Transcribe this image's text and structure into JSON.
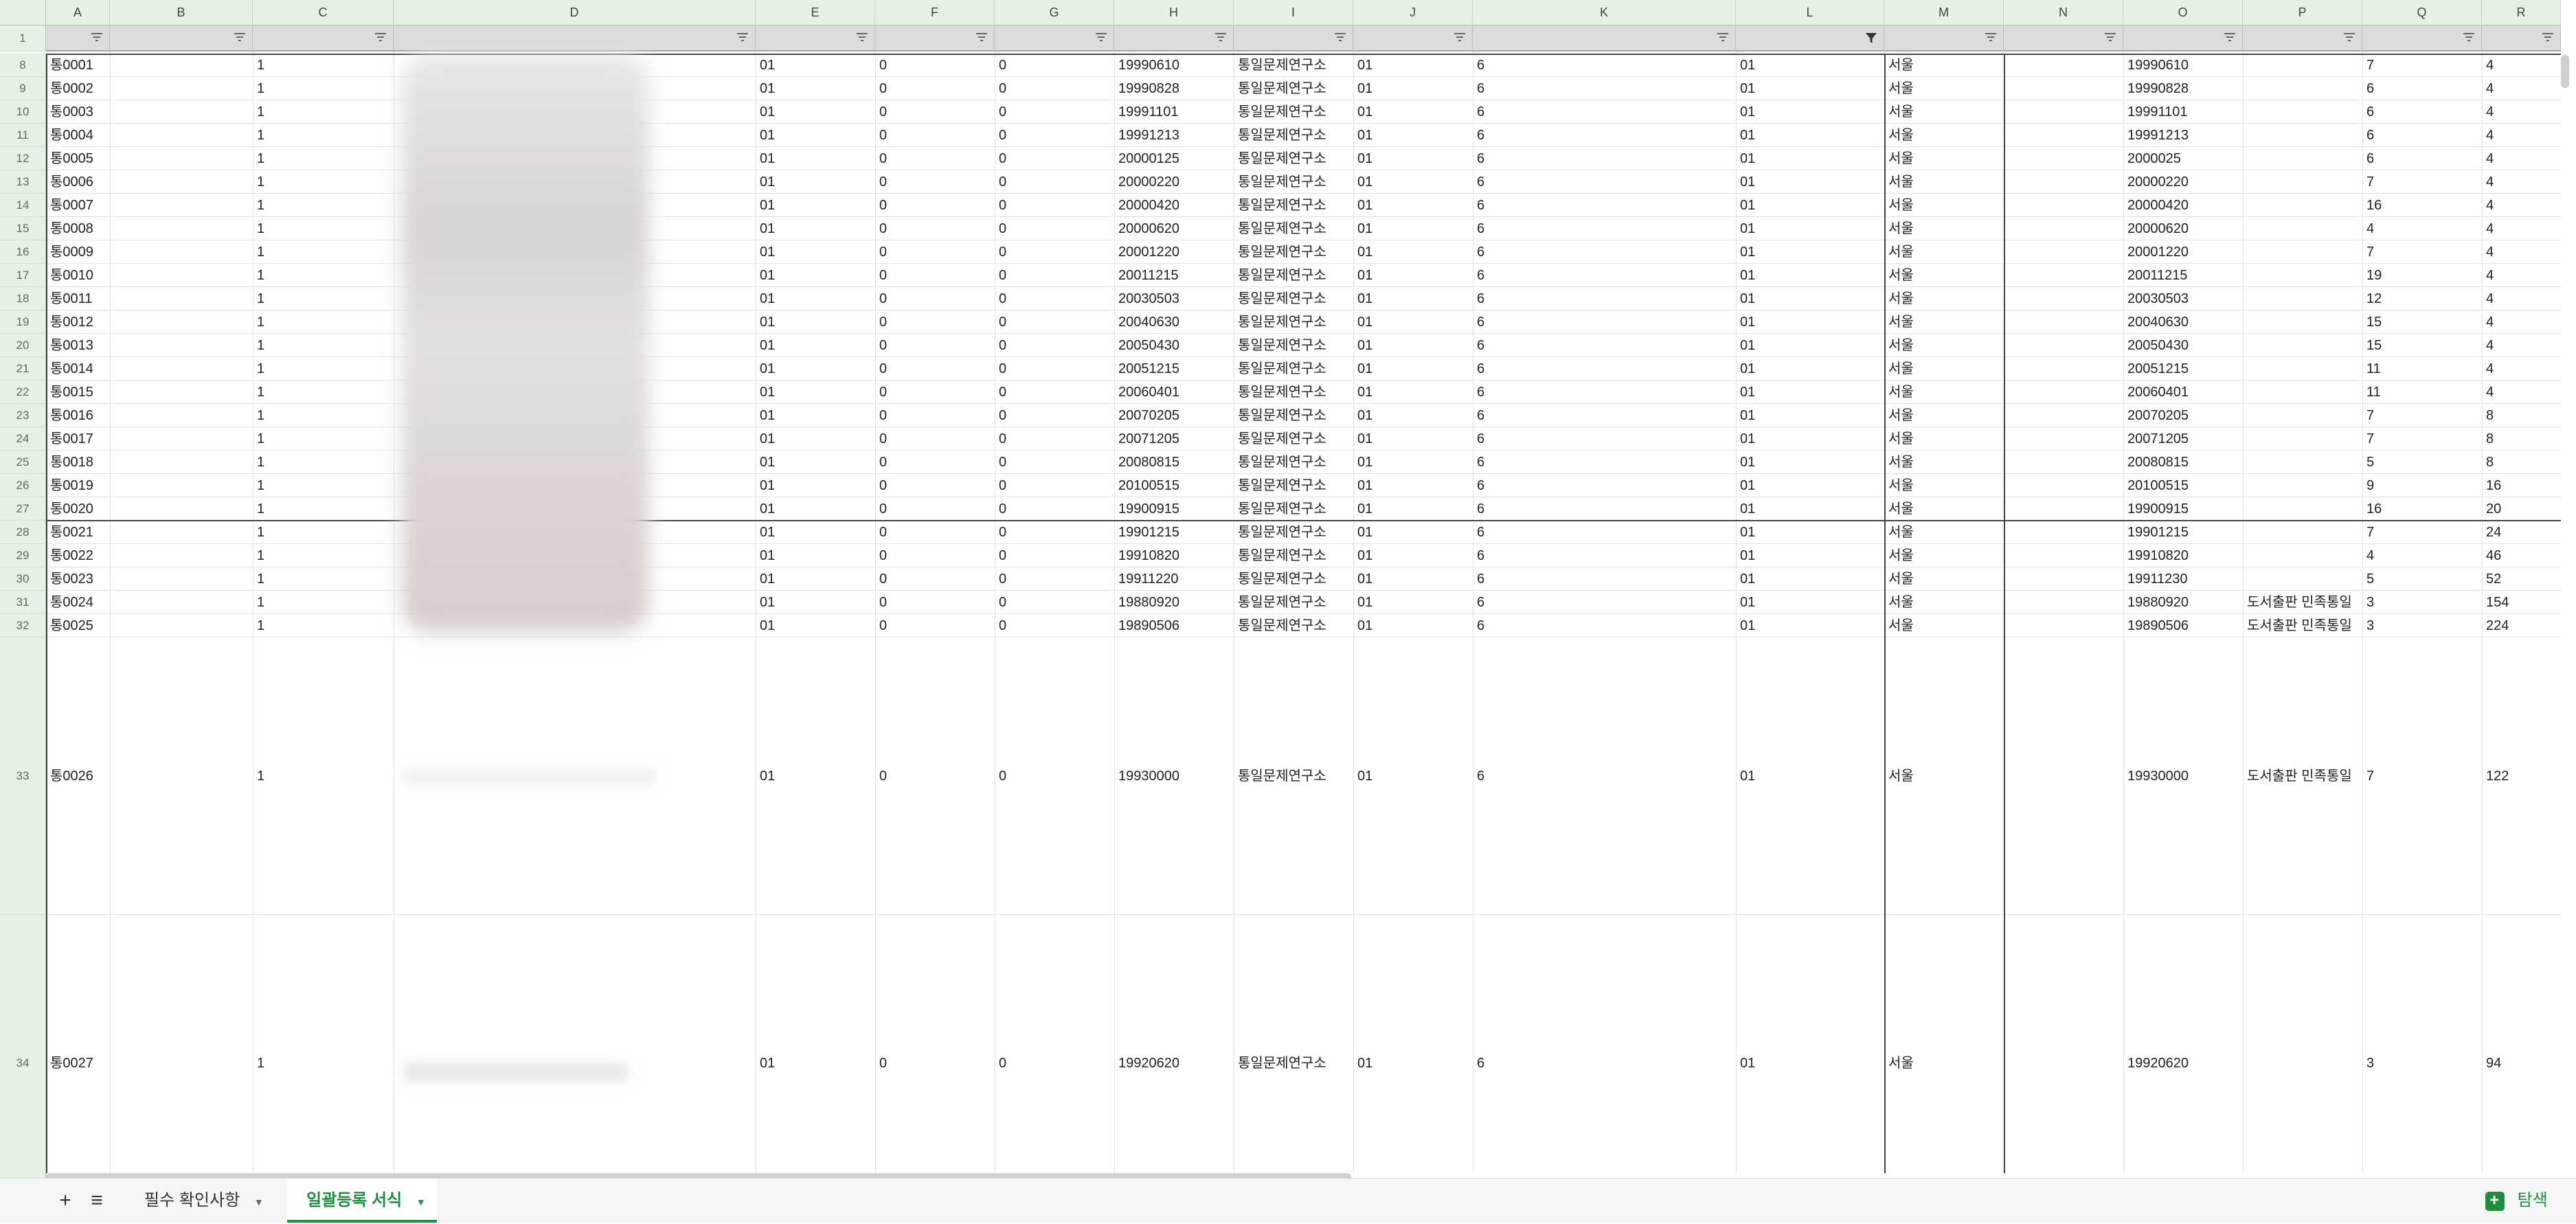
{
  "columns": [
    "A",
    "B",
    "C",
    "D",
    "E",
    "F",
    "G",
    "H",
    "I",
    "J",
    "K",
    "L",
    "M",
    "N",
    "O",
    "P",
    "Q",
    "R"
  ],
  "first_row_number": "1",
  "rows": [
    {
      "num": "8",
      "A": "통0001",
      "C": "1",
      "E": "01",
      "F": "0",
      "G": "0",
      "H": "19990610",
      "I": "통일문제연구소",
      "J": "01",
      "K": "6",
      "L": "01",
      "M": "서울",
      "O": "19990610",
      "P": "",
      "Q": "7",
      "R": "4"
    },
    {
      "num": "9",
      "A": "통0002",
      "C": "1",
      "E": "01",
      "F": "0",
      "G": "0",
      "H": "19990828",
      "I": "통일문제연구소",
      "J": "01",
      "K": "6",
      "L": "01",
      "M": "서울",
      "O": "19990828",
      "P": "",
      "Q": "6",
      "R": "4"
    },
    {
      "num": "10",
      "A": "통0003",
      "C": "1",
      "E": "01",
      "F": "0",
      "G": "0",
      "H": "19991101",
      "I": "통일문제연구소",
      "J": "01",
      "K": "6",
      "L": "01",
      "M": "서울",
      "O": "19991101",
      "P": "",
      "Q": "6",
      "R": "4"
    },
    {
      "num": "11",
      "A": "통0004",
      "C": "1",
      "E": "01",
      "F": "0",
      "G": "0",
      "H": "19991213",
      "I": "통일문제연구소",
      "J": "01",
      "K": "6",
      "L": "01",
      "M": "서울",
      "O": "19991213",
      "P": "",
      "Q": "6",
      "R": "4"
    },
    {
      "num": "12",
      "A": "통0005",
      "C": "1",
      "E": "01",
      "F": "0",
      "G": "0",
      "H": "20000125",
      "I": "통일문제연구소",
      "J": "01",
      "K": "6",
      "L": "01",
      "M": "서울",
      "O": "2000025",
      "P": "",
      "Q": "6",
      "R": "4"
    },
    {
      "num": "13",
      "A": "통0006",
      "C": "1",
      "E": "01",
      "F": "0",
      "G": "0",
      "H": "20000220",
      "I": "통일문제연구소",
      "J": "01",
      "K": "6",
      "L": "01",
      "M": "서울",
      "O": "20000220",
      "P": "",
      "Q": "7",
      "R": "4"
    },
    {
      "num": "14",
      "A": "통0007",
      "C": "1",
      "E": "01",
      "F": "0",
      "G": "0",
      "H": "20000420",
      "I": "통일문제연구소",
      "J": "01",
      "K": "6",
      "L": "01",
      "M": "서울",
      "O": "20000420",
      "P": "",
      "Q": "16",
      "R": "4"
    },
    {
      "num": "15",
      "A": "통0008",
      "C": "1",
      "E": "01",
      "F": "0",
      "G": "0",
      "H": "20000620",
      "I": "통일문제연구소",
      "J": "01",
      "K": "6",
      "L": "01",
      "M": "서울",
      "O": "20000620",
      "P": "",
      "Q": "4",
      "R": "4"
    },
    {
      "num": "16",
      "A": "통0009",
      "C": "1",
      "E": "01",
      "F": "0",
      "G": "0",
      "H": "20001220",
      "I": "통일문제연구소",
      "J": "01",
      "K": "6",
      "L": "01",
      "M": "서울",
      "O": "20001220",
      "P": "",
      "Q": "7",
      "R": "4"
    },
    {
      "num": "17",
      "A": "통0010",
      "C": "1",
      "E": "01",
      "F": "0",
      "G": "0",
      "H": "20011215",
      "I": "통일문제연구소",
      "J": "01",
      "K": "6",
      "L": "01",
      "M": "서울",
      "O": "20011215",
      "P": "",
      "Q": "19",
      "R": "4"
    },
    {
      "num": "18",
      "A": "통0011",
      "C": "1",
      "E": "01",
      "F": "0",
      "G": "0",
      "H": "20030503",
      "I": "통일문제연구소",
      "J": "01",
      "K": "6",
      "L": "01",
      "M": "서울",
      "O": "20030503",
      "P": "",
      "Q": "12",
      "R": "4"
    },
    {
      "num": "19",
      "A": "통0012",
      "C": "1",
      "E": "01",
      "F": "0",
      "G": "0",
      "H": "20040630",
      "I": "통일문제연구소",
      "J": "01",
      "K": "6",
      "L": "01",
      "M": "서울",
      "O": "20040630",
      "P": "",
      "Q": "15",
      "R": "4"
    },
    {
      "num": "20",
      "A": "통0013",
      "C": "1",
      "E": "01",
      "F": "0",
      "G": "0",
      "H": "20050430",
      "I": "통일문제연구소",
      "J": "01",
      "K": "6",
      "L": "01",
      "M": "서울",
      "O": "20050430",
      "P": "",
      "Q": "15",
      "R": "4"
    },
    {
      "num": "21",
      "A": "통0014",
      "C": "1",
      "E": "01",
      "F": "0",
      "G": "0",
      "H": "20051215",
      "I": "통일문제연구소",
      "J": "01",
      "K": "6",
      "L": "01",
      "M": "서울",
      "O": "20051215",
      "P": "",
      "Q": "11",
      "R": "4"
    },
    {
      "num": "22",
      "A": "통0015",
      "C": "1",
      "E": "01",
      "F": "0",
      "G": "0",
      "H": "20060401",
      "I": "통일문제연구소",
      "J": "01",
      "K": "6",
      "L": "01",
      "M": "서울",
      "O": "20060401",
      "P": "",
      "Q": "11",
      "R": "4"
    },
    {
      "num": "23",
      "A": "통0016",
      "C": "1",
      "E": "01",
      "F": "0",
      "G": "0",
      "H": "20070205",
      "I": "통일문제연구소",
      "J": "01",
      "K": "6",
      "L": "01",
      "M": "서울",
      "O": "20070205",
      "P": "",
      "Q": "7",
      "R": "8"
    },
    {
      "num": "24",
      "A": "통0017",
      "C": "1",
      "E": "01",
      "F": "0",
      "G": "0",
      "H": "20071205",
      "I": "통일문제연구소",
      "J": "01",
      "K": "6",
      "L": "01",
      "M": "서울",
      "O": "20071205",
      "P": "",
      "Q": "7",
      "R": "8"
    },
    {
      "num": "25",
      "A": "통0018",
      "C": "1",
      "E": "01",
      "F": "0",
      "G": "0",
      "H": "20080815",
      "I": "통일문제연구소",
      "J": "01",
      "K": "6",
      "L": "01",
      "M": "서울",
      "O": "20080815",
      "P": "",
      "Q": "5",
      "R": "8"
    },
    {
      "num": "26",
      "A": "통0019",
      "C": "1",
      "E": "01",
      "F": "0",
      "G": "0",
      "H": "20100515",
      "I": "통일문제연구소",
      "J": "01",
      "K": "6",
      "L": "01",
      "M": "서울",
      "O": "20100515",
      "P": "",
      "Q": "9",
      "R": "16"
    },
    {
      "num": "27",
      "A": "통0020",
      "C": "1",
      "E": "01",
      "F": "0",
      "G": "0",
      "H": "19900915",
      "I": "통일문제연구소",
      "J": "01",
      "K": "6",
      "L": "01",
      "M": "서울",
      "O": "19900915",
      "P": "",
      "Q": "16",
      "R": "20"
    },
    {
      "num": "28",
      "A": "통0021",
      "C": "1",
      "E": "01",
      "F": "0",
      "G": "0",
      "H": "19901215",
      "I": "통일문제연구소",
      "J": "01",
      "K": "6",
      "L": "01",
      "M": "서울",
      "O": "19901215",
      "P": "",
      "Q": "7",
      "R": "24"
    },
    {
      "num": "29",
      "A": "통0022",
      "C": "1",
      "E": "01",
      "F": "0",
      "G": "0",
      "H": "19910820",
      "I": "통일문제연구소",
      "J": "01",
      "K": "6",
      "L": "01",
      "M": "서울",
      "O": "19910820",
      "P": "",
      "Q": "4",
      "R": "46"
    },
    {
      "num": "30",
      "A": "통0023",
      "C": "1",
      "E": "01",
      "F": "0",
      "G": "0",
      "H": "19911220",
      "I": "통일문제연구소",
      "J": "01",
      "K": "6",
      "L": "01",
      "M": "서울",
      "O": "19911230",
      "P": "",
      "Q": "5",
      "R": "52"
    },
    {
      "num": "31",
      "A": "통0024",
      "C": "1",
      "E": "01",
      "F": "0",
      "G": "0",
      "H": "19880920",
      "I": "통일문제연구소",
      "J": "01",
      "K": "6",
      "L": "01",
      "M": "서울",
      "O": "19880920",
      "P": "도서출판 민족통일",
      "Q": "3",
      "R": "154"
    },
    {
      "num": "32",
      "A": "통0025",
      "C": "1",
      "E": "01",
      "F": "0",
      "G": "0",
      "H": "19890506",
      "I": "통일문제연구소",
      "J": "01",
      "K": "6",
      "L": "01",
      "M": "서울",
      "O": "19890506",
      "P": "도서출판 민족통일",
      "Q": "3",
      "R": "224"
    },
    {
      "num": "33",
      "A": "통0026",
      "C": "1",
      "E": "01",
      "F": "0",
      "G": "0",
      "H": "19930000",
      "I": "통일문제연구소",
      "J": "01",
      "K": "6",
      "L": "01",
      "M": "서울",
      "O": "19930000",
      "P": "도서출판 민족통일",
      "Q": "7",
      "R": "122"
    },
    {
      "num": "34",
      "A": "통0027",
      "C": "1",
      "E": "01",
      "F": "0",
      "G": "0",
      "H": "19920620",
      "I": "통일문제연구소",
      "J": "01",
      "K": "6",
      "L": "01",
      "M": "서울",
      "O": "19920620",
      "P": "",
      "Q": "3",
      "R": "94"
    }
  ],
  "tabs": {
    "add": "+",
    "list": "≡",
    "sheet1": "필수 확인사항",
    "sheet2": "일괄등록 서식",
    "explore": "탐색"
  },
  "icons": {
    "filter": "filter-icon",
    "filter_active": "filter-active-icon",
    "add": "plus-icon",
    "list": "sheet-list-icon",
    "explore": "explore-icon"
  },
  "colors": {
    "accent": "#1e8e3e",
    "header_bg": "#e6f1e6",
    "filter_bg": "#dcdcdc"
  }
}
